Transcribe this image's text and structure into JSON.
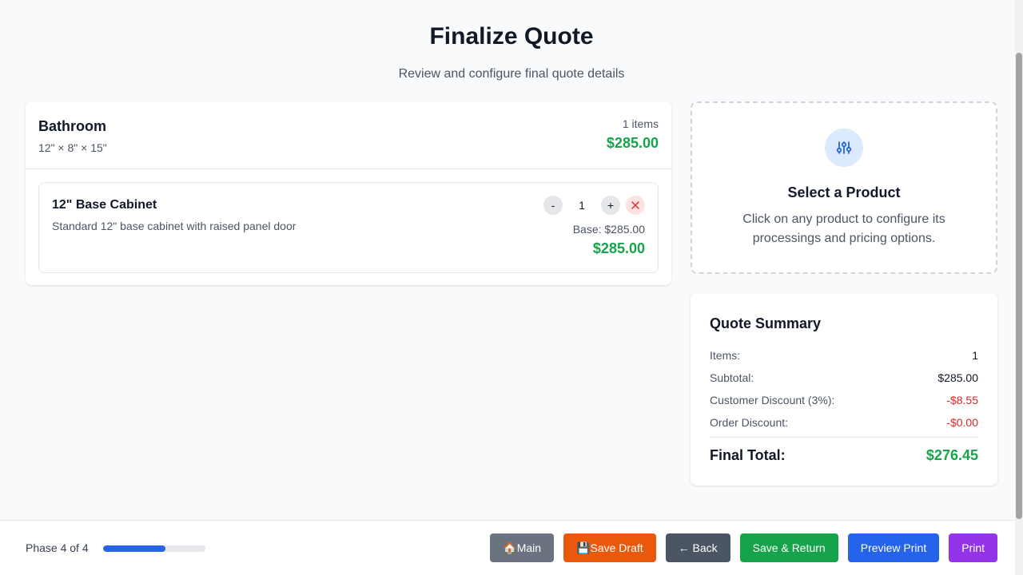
{
  "header": {
    "title": "Finalize Quote",
    "subtitle": "Review and configure final quote details"
  },
  "room": {
    "name": "Bathroom",
    "dimensions": "12\" × 8\" × 15\"",
    "item_count": "1 items",
    "total": "$285.00",
    "products": [
      {
        "name": "12\" Base Cabinet",
        "description": "Standard 12\" base cabinet with raised panel door",
        "quantity": "1",
        "decrement_label": "-",
        "increment_label": "+",
        "base_price": "Base: $285.00",
        "total": "$285.00"
      }
    ]
  },
  "select_panel": {
    "icon": "sliders-icon",
    "title": "Select a Product",
    "description": "Click on any product to configure its processings and pricing options."
  },
  "summary": {
    "title": "Quote Summary",
    "rows": [
      {
        "label": "Items:",
        "value": "1"
      },
      {
        "label": "Subtotal:",
        "value": "$285.00"
      },
      {
        "label": "Customer Discount (3%):",
        "value": "-$8.55"
      },
      {
        "label": "Order Discount:",
        "value": "-$0.00"
      }
    ],
    "final_label": "Final Total:",
    "final_value": "$276.45"
  },
  "footer": {
    "phase": "Phase 4 of 4",
    "progress_fraction": 0.61,
    "buttons": {
      "main": "🏠Main",
      "save_draft": "💾Save Draft",
      "back": "← Back",
      "save_return": "Save & Return",
      "preview_print": "Preview Print",
      "print": "Print"
    }
  },
  "colors": {
    "accent_green": "#16a34a",
    "accent_blue": "#2563eb",
    "discount_red": "#dc2626",
    "draft_orange": "#ea580c",
    "print_purple": "#9333ea"
  }
}
